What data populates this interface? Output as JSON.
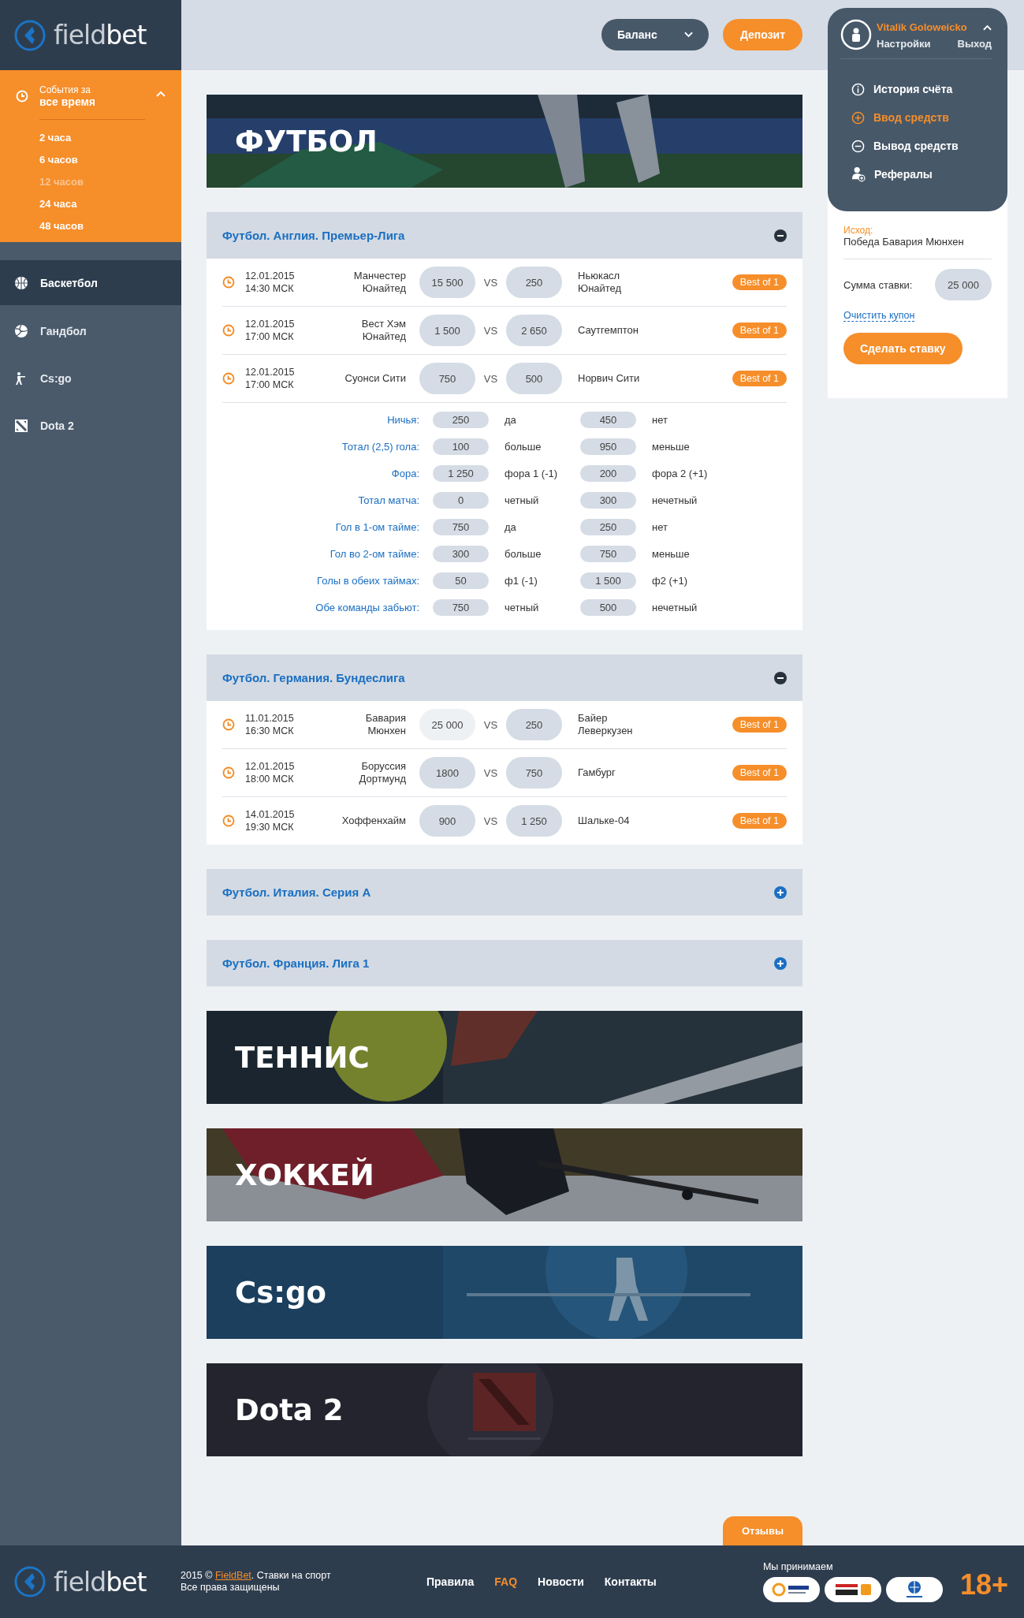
{
  "logo": {
    "part1": "field",
    "part2": "bet"
  },
  "sidebar": {
    "period": {
      "label": "События за",
      "value": "все время",
      "expanded": true,
      "options": [
        {
          "label": "2 часа",
          "selected": false
        },
        {
          "label": "6 часов",
          "selected": false
        },
        {
          "label": "12 часов",
          "selected": true
        },
        {
          "label": "24 часа",
          "selected": false
        },
        {
          "label": "48 часов",
          "selected": false
        }
      ]
    },
    "sports": [
      {
        "label": "Баскетбол",
        "kind": "basketball",
        "selected": true
      },
      {
        "label": "Гандбол",
        "kind": "handball",
        "selected": false
      },
      {
        "label": "Cs:go",
        "kind": "csgo",
        "selected": false
      },
      {
        "label": "Dota 2",
        "kind": "dota",
        "selected": false
      }
    ]
  },
  "header": {
    "balance": "Баланс",
    "deposit": "Депозит"
  },
  "user_menu": {
    "name": "Vitalik Goloweicko",
    "expanded": true,
    "settings": "Настройки",
    "logout": "Выход",
    "items": [
      {
        "label": "История счёта",
        "kind": "info",
        "selected": false
      },
      {
        "label": "Ввод средств",
        "kind": "plus",
        "selected": true
      },
      {
        "label": "Вывод средств",
        "kind": "minus",
        "selected": false
      },
      {
        "label": "Рефералы",
        "kind": "referral",
        "selected": false
      }
    ]
  },
  "coupon": {
    "outcome_label": "Исход:",
    "outcome": "Победа Бавария Мюнхен",
    "stake_label": "Сумма ставки:",
    "stake": "25 000",
    "clear": "Очистить купон",
    "submit": "Сделать ставку"
  },
  "sections": [
    {
      "kind": "banner",
      "title": "ФУТБОЛ"
    },
    {
      "kind": "league",
      "title": "Футбол. Англия. Премьер-Лига",
      "expanded": true,
      "matches": [
        {
          "date": "12.01.2015",
          "time": "14:30 МСК",
          "home": "Манчестер Юнайтед",
          "home_odds": {
            "value": "15 500",
            "selected": false
          },
          "vs": "VS",
          "away_odds": {
            "value": "250",
            "selected": false
          },
          "away": "Ньюкасл Юнайтед",
          "format": "Best of 1"
        },
        {
          "date": "12.01.2015",
          "time": "17:00 МСК",
          "home": "Вест Хэм Юнайтед",
          "home_odds": {
            "value": "1 500",
            "selected": false
          },
          "vs": "VS",
          "away_odds": {
            "value": "2 650",
            "selected": false
          },
          "away": "Саутгемптон",
          "format": "Best of 1"
        },
        {
          "date": "12.01.2015",
          "time": "17:00 МСК",
          "home": "Суонси Сити",
          "home_odds": {
            "value": "750",
            "selected": false
          },
          "vs": "VS",
          "away_odds": {
            "value": "500",
            "selected": false
          },
          "away": "Норвич Сити",
          "format": "Best of 1"
        }
      ],
      "extras": [
        {
          "label": "Ничья:",
          "odds1": "250",
          "outcome1": "да",
          "odds2": "450",
          "outcome2": "нет"
        },
        {
          "label": "Тотал (2,5) гола:",
          "odds1": "100",
          "outcome1": "больше",
          "odds2": "950",
          "outcome2": "меньше"
        },
        {
          "label": "Фора:",
          "odds1": "1 250",
          "outcome1": "фора 1 (-1)",
          "odds2": "200",
          "outcome2": "фора 2 (+1)"
        },
        {
          "label": "Тотал матча:",
          "odds1": "0",
          "outcome1": "четный",
          "odds2": "300",
          "outcome2": "нечетный"
        },
        {
          "label": "Гол в 1-ом тайме:",
          "odds1": "750",
          "outcome1": "да",
          "odds2": "250",
          "outcome2": "нет"
        },
        {
          "label": "Гол во 2-ом тайме:",
          "odds1": "300",
          "outcome1": "больше",
          "odds2": "750",
          "outcome2": "меньше"
        },
        {
          "label": "Голы в обеих таймах:",
          "odds1": "50",
          "outcome1": "ф1 (-1)",
          "odds2": "1 500",
          "outcome2": "ф2 (+1)"
        },
        {
          "label": "Обе команды забьют:",
          "odds1": "750",
          "outcome1": "четный",
          "odds2": "500",
          "outcome2": "нечетный"
        }
      ]
    },
    {
      "kind": "league",
      "title": "Футбол. Германия. Бундеслига",
      "expanded": true,
      "matches": [
        {
          "date": "11.01.2015",
          "time": "16:30 МСК",
          "home": "Бавария Мюнхен",
          "home_odds": {
            "value": "25 000",
            "selected": true
          },
          "vs": "VS",
          "away_odds": {
            "value": "250",
            "selected": false
          },
          "away": "Байер Леверкузен",
          "format": "Best of 1"
        },
        {
          "date": "12.01.2015",
          "time": "18:00 МСК",
          "home": "Боруссия Дортмунд",
          "home_odds": {
            "value": "1800",
            "selected": false
          },
          "vs": "VS",
          "away_odds": {
            "value": "750",
            "selected": false
          },
          "away": "Гамбург",
          "format": "Best of 1"
        },
        {
          "date": "14.01.2015",
          "time": "19:30 МСК",
          "home": "Хоффенхайм",
          "home_odds": {
            "value": "900",
            "selected": false
          },
          "vs": "VS",
          "away_odds": {
            "value": "1 250",
            "selected": false
          },
          "away": "Шальке-04",
          "format": "Best of 1"
        }
      ]
    },
    {
      "kind": "league",
      "title": "Футбол. Италия. Серия А",
      "expanded": false
    },
    {
      "kind": "league",
      "title": "Футбол. Франция. Лига 1",
      "expanded": false
    },
    {
      "kind": "banner",
      "title": "ТЕННИС"
    },
    {
      "kind": "banner",
      "title": "ХОККЕЙ"
    },
    {
      "kind": "banner",
      "title": "Cs:go"
    },
    {
      "kind": "banner",
      "title": "Dota 2"
    }
  ],
  "feedback": "Отзывы",
  "footer": {
    "logo": {
      "part1": "field",
      "part2": "bet"
    },
    "copyright_pre": "2015 © ",
    "copyright_link": "FieldBet",
    "copyright_post": ". Ставки на спорт",
    "rights": "Все права защищены",
    "links": [
      {
        "label": "Правила",
        "selected": false
      },
      {
        "label": "FAQ",
        "selected": true
      },
      {
        "label": "Новости",
        "selected": false
      },
      {
        "label": "Контакты",
        "selected": false
      }
    ],
    "accept": "Мы принимаем",
    "age": "18+"
  }
}
